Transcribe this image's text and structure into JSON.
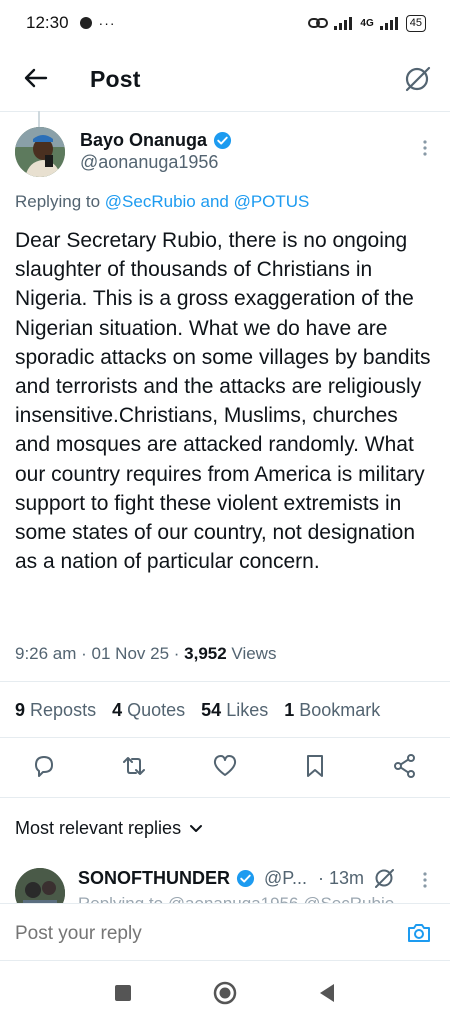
{
  "status_bar": {
    "time": "12:30",
    "extra": "• ···",
    "network": "4G",
    "battery": "45"
  },
  "header": {
    "title": "Post"
  },
  "tweet": {
    "author_name": "Bayo Onanuga",
    "author_handle": "@aonanuga1956",
    "replying_prefix": "Replying to",
    "replying_mentions": "@SecRubio and @POTUS",
    "text": "Dear Secretary Rubio, there is no ongoing slaughter of thousands of Christians in Nigeria. This is a gross exaggeration of the Nigerian situation. What we do have are sporadic attacks on some villages by bandits and terrorists and the attacks are religiously insensitive.Christians, Muslims, churches and mosques are attacked randomly. What our country requires from America is military support to fight these violent extremists in some states of our country, not designation as a nation of particular concern.",
    "time": "9:26 am · 01 Nov 25 · ",
    "views_count": "3,952",
    "views_label": " Views"
  },
  "stats": {
    "reposts_count": "9",
    "reposts_label": "Reposts",
    "quotes_count": "4",
    "quotes_label": "Quotes",
    "likes_count": "54",
    "likes_label": "Likes",
    "bookmarks_count": "1",
    "bookmarks_label": "Bookmark"
  },
  "replies": {
    "sort_label": "Most relevant replies",
    "first": {
      "name": "SONOFTHUNDER",
      "handle": "@P...",
      "time": "· 13m",
      "partial": "Replying to @aonanuga1956 @SecRubio"
    }
  },
  "compose": {
    "placeholder": "Post your reply"
  },
  "colors": {
    "accent": "#1d9bf0",
    "secondary_text": "#536471",
    "primary_text": "#0f1419"
  },
  "icons": [
    "back-arrow-icon",
    "grok-icon",
    "more-vertical-icon",
    "verified-badge-icon",
    "reply-icon",
    "repost-icon",
    "like-icon",
    "bookmark-icon",
    "share-icon",
    "chevron-down-icon",
    "camera-icon",
    "square-nav-icon",
    "home-nav-icon",
    "back-nav-icon"
  ]
}
